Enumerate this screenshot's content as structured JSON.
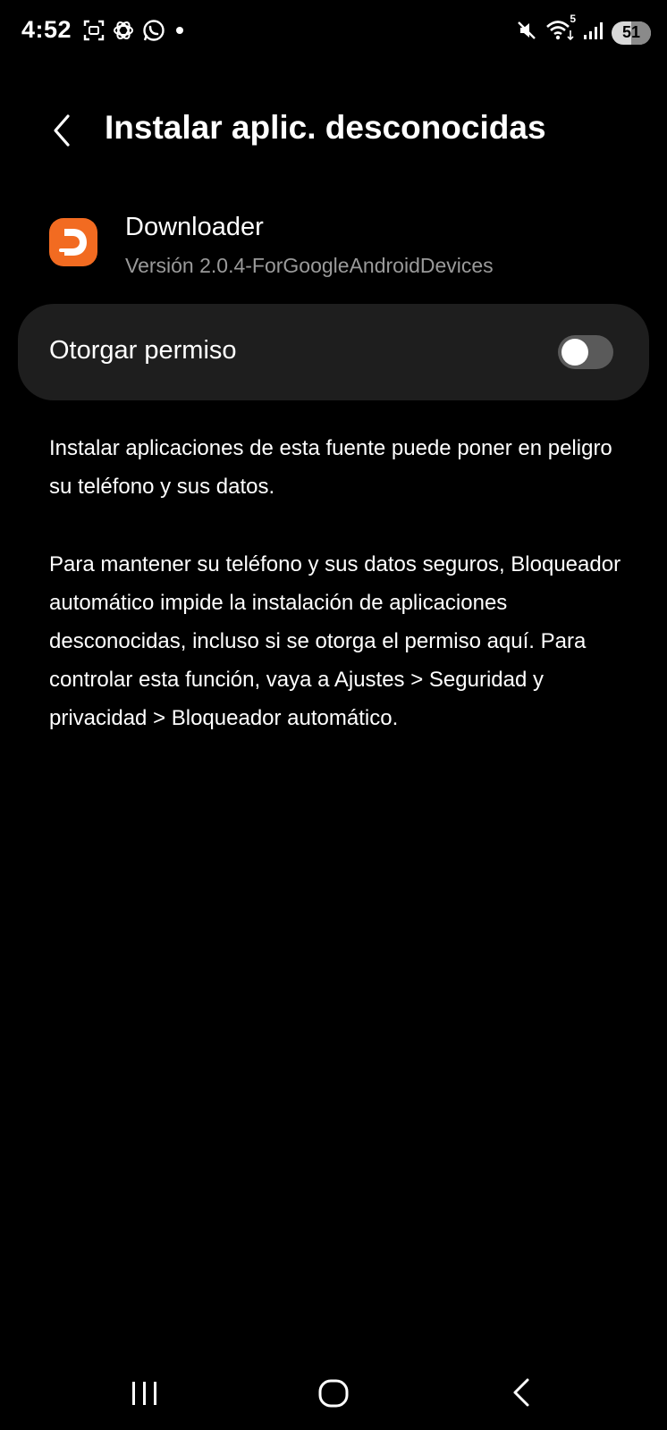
{
  "status_bar": {
    "time": "4:52",
    "network_type": "5",
    "battery_level": "51",
    "battery_fraction": 0.51,
    "icons": [
      "screen-recorder-icon",
      "openai-icon",
      "whatsapp-icon",
      "notification-dot-icon",
      "mute-icon",
      "wifi-icon",
      "signal-icon",
      "battery-icon"
    ]
  },
  "header": {
    "title": "Instalar aplic. desconocidas",
    "back_icon": "chevron-left-icon"
  },
  "app": {
    "name": "Downloader",
    "version": "Versión 2.0.4-ForGoogleAndroidDevices",
    "icon": "downloader-app-icon",
    "icon_color": "#f26b21"
  },
  "permission": {
    "label": "Otorgar permiso",
    "enabled": false
  },
  "description": {
    "paragraph1": "Instalar aplicaciones de esta fuente puede poner en peligro su teléfono y sus datos.",
    "paragraph2": "Para mantener su teléfono y sus datos seguros, Bloqueador automático impide la instalación de aplicaciones desconocidas, incluso si se otorga el permiso aquí. Para controlar esta función, vaya a Ajustes > Seguridad y privacidad > Bloqueador automático."
  },
  "nav_bar": {
    "icons": [
      "recents-icon",
      "home-icon",
      "back-icon"
    ]
  }
}
